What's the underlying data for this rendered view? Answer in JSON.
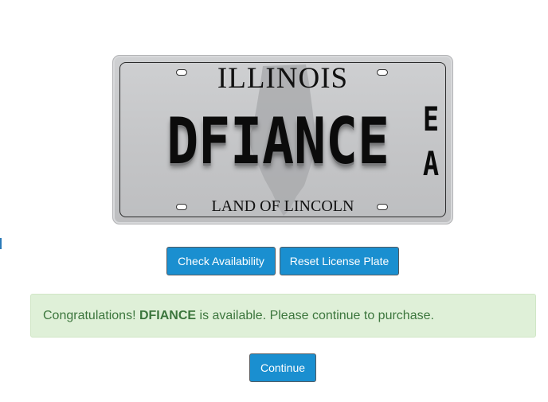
{
  "plate": {
    "state": "ILLINOIS",
    "number": "DFIANCE",
    "sticker": [
      "E",
      "A"
    ],
    "motto": "LAND OF LINCOLN"
  },
  "buttons": {
    "check_label": "Check Availability",
    "reset_label": "Reset License Plate",
    "continue_label": "Continue"
  },
  "alert": {
    "prefix": "Congratulations!",
    "plate": "DFIANCE",
    "suffix": "is available. Please continue to purchase."
  },
  "colors": {
    "button_bg": "#1a8fd0",
    "alert_bg": "#dff0d8",
    "alert_text": "#3c763d"
  }
}
